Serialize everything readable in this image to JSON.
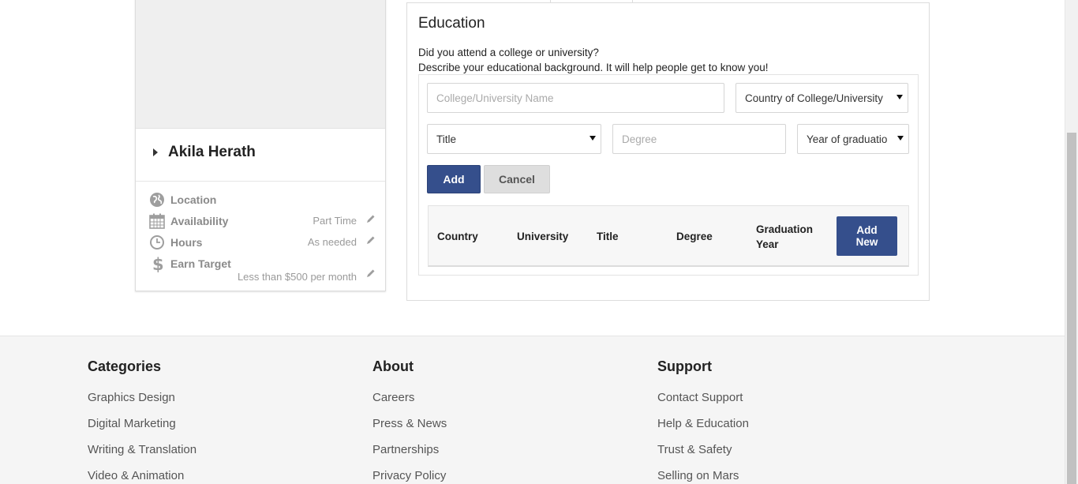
{
  "profile": {
    "name": "Akila Herath",
    "rows": [
      {
        "label": "Location",
        "value": ""
      },
      {
        "label": "Availability",
        "value": "Part Time"
      },
      {
        "label": "Hours",
        "value": "As needed"
      },
      {
        "label": "Earn Target",
        "value": "Less than $500 per month"
      }
    ]
  },
  "education": {
    "title": "Education",
    "question": "Did you attend a college or university?",
    "description": "Describe your educational background. It will help people get to know you!",
    "college_placeholder": "College/University Name",
    "country_select": "Country of College/University",
    "title_select": "Title",
    "degree_placeholder": "Degree",
    "year_select": "Year of graduatio",
    "add_button": "Add",
    "cancel_button": "Cancel",
    "table": {
      "headers": [
        "Country",
        "University",
        "Title",
        "Degree",
        "Graduation Year"
      ],
      "add_new_button": "Add New"
    }
  },
  "footer": {
    "categories": {
      "heading": "Categories",
      "links": [
        "Graphics Design",
        "Digital Marketing",
        "Writing & Translation",
        "Video & Animation"
      ]
    },
    "about": {
      "heading": "About",
      "links": [
        "Careers",
        "Press & News",
        "Partnerships",
        "Privacy Policy"
      ]
    },
    "support": {
      "heading": "Support",
      "links": [
        "Contact Support",
        "Help & Education",
        "Trust & Safety",
        "Selling on Mars"
      ]
    }
  },
  "colors": {
    "primary": "#354f8c",
    "secondary_button": "#dedede",
    "footer_bg": "#f5f5f5"
  }
}
